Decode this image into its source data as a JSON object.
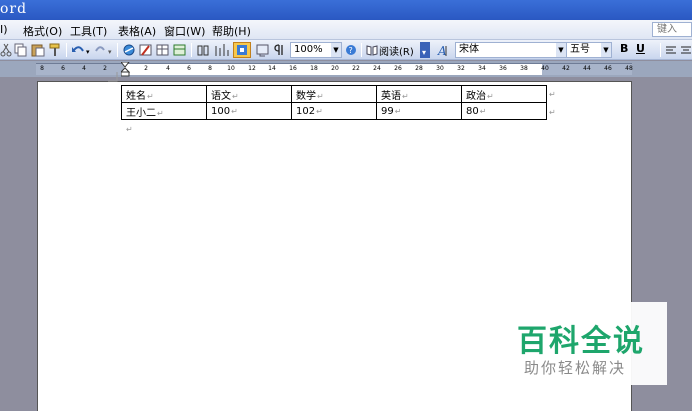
{
  "window": {
    "title": "ord"
  },
  "menubar": {
    "items": [
      "I)",
      "格式(O)",
      "工具(T)",
      "表格(A)",
      "窗口(W)",
      "帮助(H)"
    ],
    "help_box": "键入"
  },
  "toolbar": {
    "zoom": "100%",
    "read_label": "阅读(R)",
    "font_name": "宋体",
    "font_size": "五号",
    "bold": "B",
    "underline": "U"
  },
  "ruler": {
    "ticks": [
      "8",
      "6",
      "4",
      "2",
      "2",
      "4",
      "6",
      "8",
      "10",
      "12",
      "14",
      "16",
      "18",
      "20",
      "22",
      "24",
      "26",
      "28",
      "30",
      "32",
      "34",
      "36",
      "38",
      "40",
      "42",
      "44",
      "46",
      "48"
    ]
  },
  "document": {
    "table": {
      "headers": [
        "姓名",
        "语文",
        "数学",
        "英语",
        "政治"
      ],
      "rows": [
        [
          "王小二",
          "100",
          "102",
          "99",
          "80"
        ]
      ]
    },
    "paragraph_mark": "↵",
    "cell_mark": "↵"
  },
  "watermark": {
    "main": "百科全说",
    "sub": "助你轻松解决"
  }
}
